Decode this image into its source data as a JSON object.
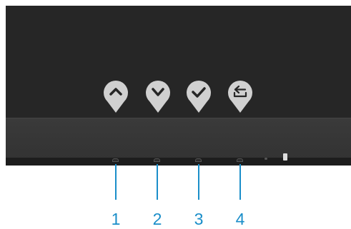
{
  "osd_buttons": [
    {
      "icon": "chevron-up-icon",
      "name": "up-button"
    },
    {
      "icon": "chevron-down-icon",
      "name": "down-button"
    },
    {
      "icon": "check-icon",
      "name": "confirm-button"
    },
    {
      "icon": "back-icon",
      "name": "back-button"
    }
  ],
  "callouts": {
    "c1": "1",
    "c2": "2",
    "c3": "3",
    "c4": "4"
  },
  "colors": {
    "screen": "#262626",
    "bezel": "#363636",
    "pin": "#d0d0d0",
    "callout": "#1a8ec9"
  }
}
